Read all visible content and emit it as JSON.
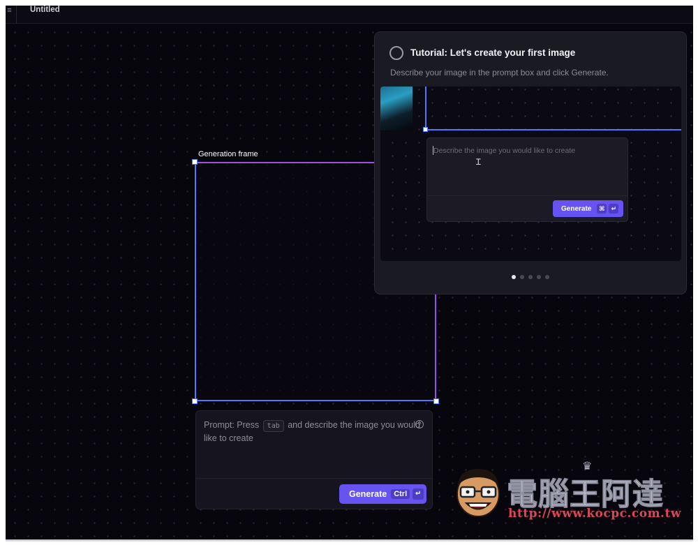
{
  "app": {
    "document_title": "Untitled",
    "menu_icon": "hamburger-icon"
  },
  "canvas": {
    "frame_label": "Generation frame",
    "frame_colors": {
      "edge_blue": "#4d7bff",
      "edge_purple": "#a14ee6"
    }
  },
  "prompt": {
    "text_before": "Prompt: Press",
    "key_label": "tab",
    "text_after": "and describe the image you would like to create",
    "help_icon": "question-circle-icon",
    "generate_label": "Generate",
    "shortcut_ctrl": "Ctrl",
    "shortcut_enter": "↵",
    "button_color": "#6653f0"
  },
  "tutorial": {
    "title": "Tutorial: Let's create your first image",
    "description": "Describe your image in the prompt box and click Generate.",
    "preview_placeholder": "Describe the image you would like to create",
    "preview_generate_label": "Generate",
    "preview_shortcut_cmd": "⌘",
    "preview_shortcut_enter": "↵",
    "steps_total": 5,
    "current_step": 1
  },
  "watermark": {
    "chinese_text": "電腦王阿達",
    "url": "http://www.kocpc.com.tw"
  }
}
